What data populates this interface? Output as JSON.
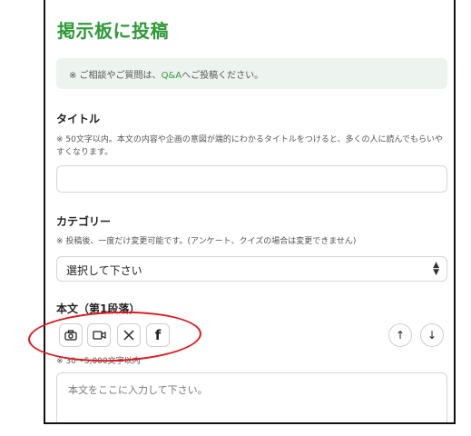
{
  "page": {
    "title": "掲示板に投稿",
    "notice": {
      "prefix": "※ ご相談やご質問は、",
      "link": "Q&A",
      "suffix": "へご投稿ください。"
    }
  },
  "title_field": {
    "label": "タイトル",
    "help": "※ 50文字以内。本文の内容や企画の意図が端的にわかるタイトルをつけると、多くの人に読んでもらいやすくなります。",
    "value": ""
  },
  "category_field": {
    "label": "カテゴリー",
    "help": "※ 投稿後、一度だけ変更可能です。(アンケート、クイズの場合は変更できません)",
    "selected": "選択して下さい"
  },
  "body_field": {
    "label": "本文（第1段落）",
    "help": "※ 30〜5,000文字以内",
    "placeholder": "本文をここに入力して下さい。",
    "toolbar": [
      "camera-icon",
      "video-icon",
      "x-icon",
      "facebook-icon",
      "arrow-up-icon",
      "arrow-down-icon"
    ]
  },
  "colors": {
    "brand_green": "#2e9a3a",
    "notice_bg": "#edf3ee",
    "annotation_red": "#e0181c"
  }
}
